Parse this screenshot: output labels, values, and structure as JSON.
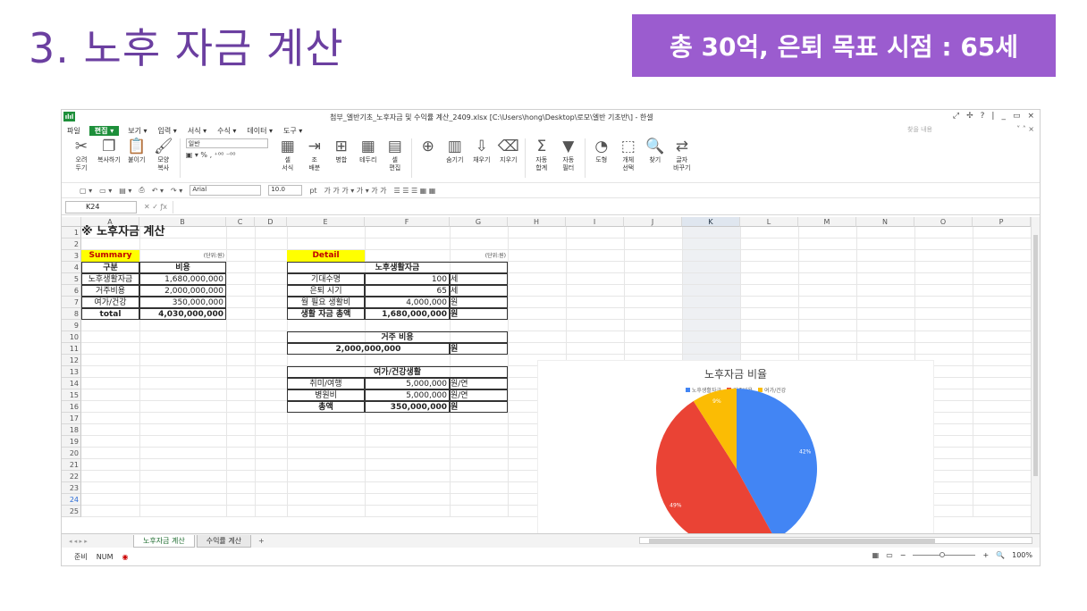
{
  "slide": {
    "title": "3. 노후 자금 계산",
    "banner": "총 30억, 은퇴 목표 시점 : 65세"
  },
  "window": {
    "app_icon": "ılıl",
    "doc_title": "첨부_엘반기초_노후자금 및 수익률 계산_2409.xlsx [C:\\Users\\hong\\Desktop\\로모\\엘반 기초반\\] - 한셀",
    "search_placeholder": "찾을 내용",
    "controls": [
      "⤢",
      "✢",
      "?",
      "|",
      "_",
      "▭",
      "×"
    ]
  },
  "menu": [
    {
      "label": "파일",
      "active": false
    },
    {
      "label": "편집 ▾",
      "active": true
    },
    {
      "label": "보기 ▾",
      "active": false
    },
    {
      "label": "입력 ▾",
      "active": false
    },
    {
      "label": "서식 ▾",
      "active": false
    },
    {
      "label": "수식 ▾",
      "active": false
    },
    {
      "label": "데이터 ▾",
      "active": false
    },
    {
      "label": "도구 ▾",
      "active": false
    }
  ],
  "ribbon": [
    {
      "name": "cut",
      "icon": "✂",
      "label": "오려\n두기"
    },
    {
      "name": "copy",
      "icon": "❐",
      "label": "복사하기"
    },
    {
      "name": "paste",
      "icon": "📋",
      "label": "붙이기"
    },
    {
      "name": "format-copy",
      "icon": "🖌",
      "label": "모양\n복사"
    },
    {
      "name": "cell-format",
      "icon": "▦",
      "label": "셀\n서식"
    },
    {
      "name": "wrap",
      "icon": "⇥",
      "label": "조\n배분"
    },
    {
      "name": "merge",
      "icon": "⊞",
      "label": "병합"
    },
    {
      "name": "border",
      "icon": "▦",
      "label": "테두리"
    },
    {
      "name": "cell-edit",
      "icon": "▤",
      "label": "셀\n편집"
    },
    {
      "name": "insert",
      "icon": "⊕",
      "label": ""
    },
    {
      "name": "hide",
      "icon": "▥",
      "label": "숨기기"
    },
    {
      "name": "fill",
      "icon": "⇩",
      "label": "채우기"
    },
    {
      "name": "clear",
      "icon": "⌫",
      "label": "지우기"
    },
    {
      "name": "autosum",
      "icon": "Σ",
      "label": "자동\n합계"
    },
    {
      "name": "filter",
      "icon": "▼",
      "label": "자동\n필터"
    },
    {
      "name": "shape",
      "icon": "◔",
      "label": "도형"
    },
    {
      "name": "object-select",
      "icon": "⬚",
      "label": "개체\n선택"
    },
    {
      "name": "find",
      "icon": "🔍",
      "label": "찾기"
    },
    {
      "name": "replace",
      "icon": "⇄",
      "label": "글자\n바꾸기"
    }
  ],
  "ribbon_number": {
    "format": "일반",
    "symbols": "▣ ▾ %  ,  ⁺⁰⁰ ⁻⁰⁰"
  },
  "toolbar": {
    "font": "Arial",
    "size": "10.0",
    "unit": "pt",
    "styles": "가 가 가 ▾ 가 ▾ 가 가",
    "align": "☰ ☰ ☰ ▦ ▦"
  },
  "formula": {
    "cell_ref": "K24",
    "fx": "✕ ✓ ƒx"
  },
  "columns": [
    "A",
    "B",
    "C",
    "D",
    "E",
    "F",
    "G",
    "H",
    "I",
    "J",
    "K",
    "L",
    "M",
    "N",
    "O",
    "P"
  ],
  "rows": [
    "1",
    "2",
    "3",
    "4",
    "5",
    "6",
    "7",
    "8",
    "9",
    "10",
    "11",
    "12",
    "13",
    "14",
    "15",
    "16",
    "17",
    "18",
    "19",
    "20",
    "21",
    "22",
    "23",
    "24",
    "25"
  ],
  "sheet": {
    "title": "※ 노후자금 계산",
    "summary_label": "Summary",
    "summary_unit": "(단위:원)",
    "summary_headers": [
      "구분",
      "비용"
    ],
    "summary_rows": [
      [
        "노후생활자금",
        "1,680,000,000"
      ],
      [
        "거주비용",
        "2,000,000,000"
      ],
      [
        "여가/건강",
        "350,000,000"
      ],
      [
        "total",
        "4,030,000,000"
      ]
    ],
    "detail_label": "Detail",
    "detail_unit": "(단위:원)",
    "living_title": "노후생활자금",
    "living_rows": [
      [
        "기대수명",
        "100",
        "세"
      ],
      [
        "은퇴 시기",
        "65",
        "세"
      ],
      [
        "월 필요 생활비",
        "4,000,000",
        "원"
      ],
      [
        "생활 자금 총액",
        "1,680,000,000",
        "원"
      ]
    ],
    "housing_title": "거주 비용",
    "housing_row": [
      "2,000,000,000",
      "원"
    ],
    "leisure_title": "여가/건강생활",
    "leisure_rows": [
      [
        "취미/여행",
        "5,000,000",
        "원/연"
      ],
      [
        "병원비",
        "5,000,000",
        "원/연"
      ],
      [
        "총액",
        "350,000,000",
        "원"
      ]
    ]
  },
  "chart_data": {
    "type": "pie",
    "title": "노후자금 비율",
    "categories": [
      "노후생활자금",
      "거주비용",
      "여가/건강"
    ],
    "values": [
      42,
      49,
      9
    ],
    "labels": [
      "42%",
      "49%",
      "9%"
    ],
    "colors": [
      "#4285f4",
      "#ea4335",
      "#fbbc04"
    ],
    "legend": "top"
  },
  "tabs": {
    "nav": "◂ ◂ ▸ ▸",
    "sheets": [
      "노후자금 계산",
      "수익률 계산"
    ],
    "add": "+"
  },
  "status": {
    "mode": "준비",
    "num": "NUM",
    "zoom": "100%"
  }
}
